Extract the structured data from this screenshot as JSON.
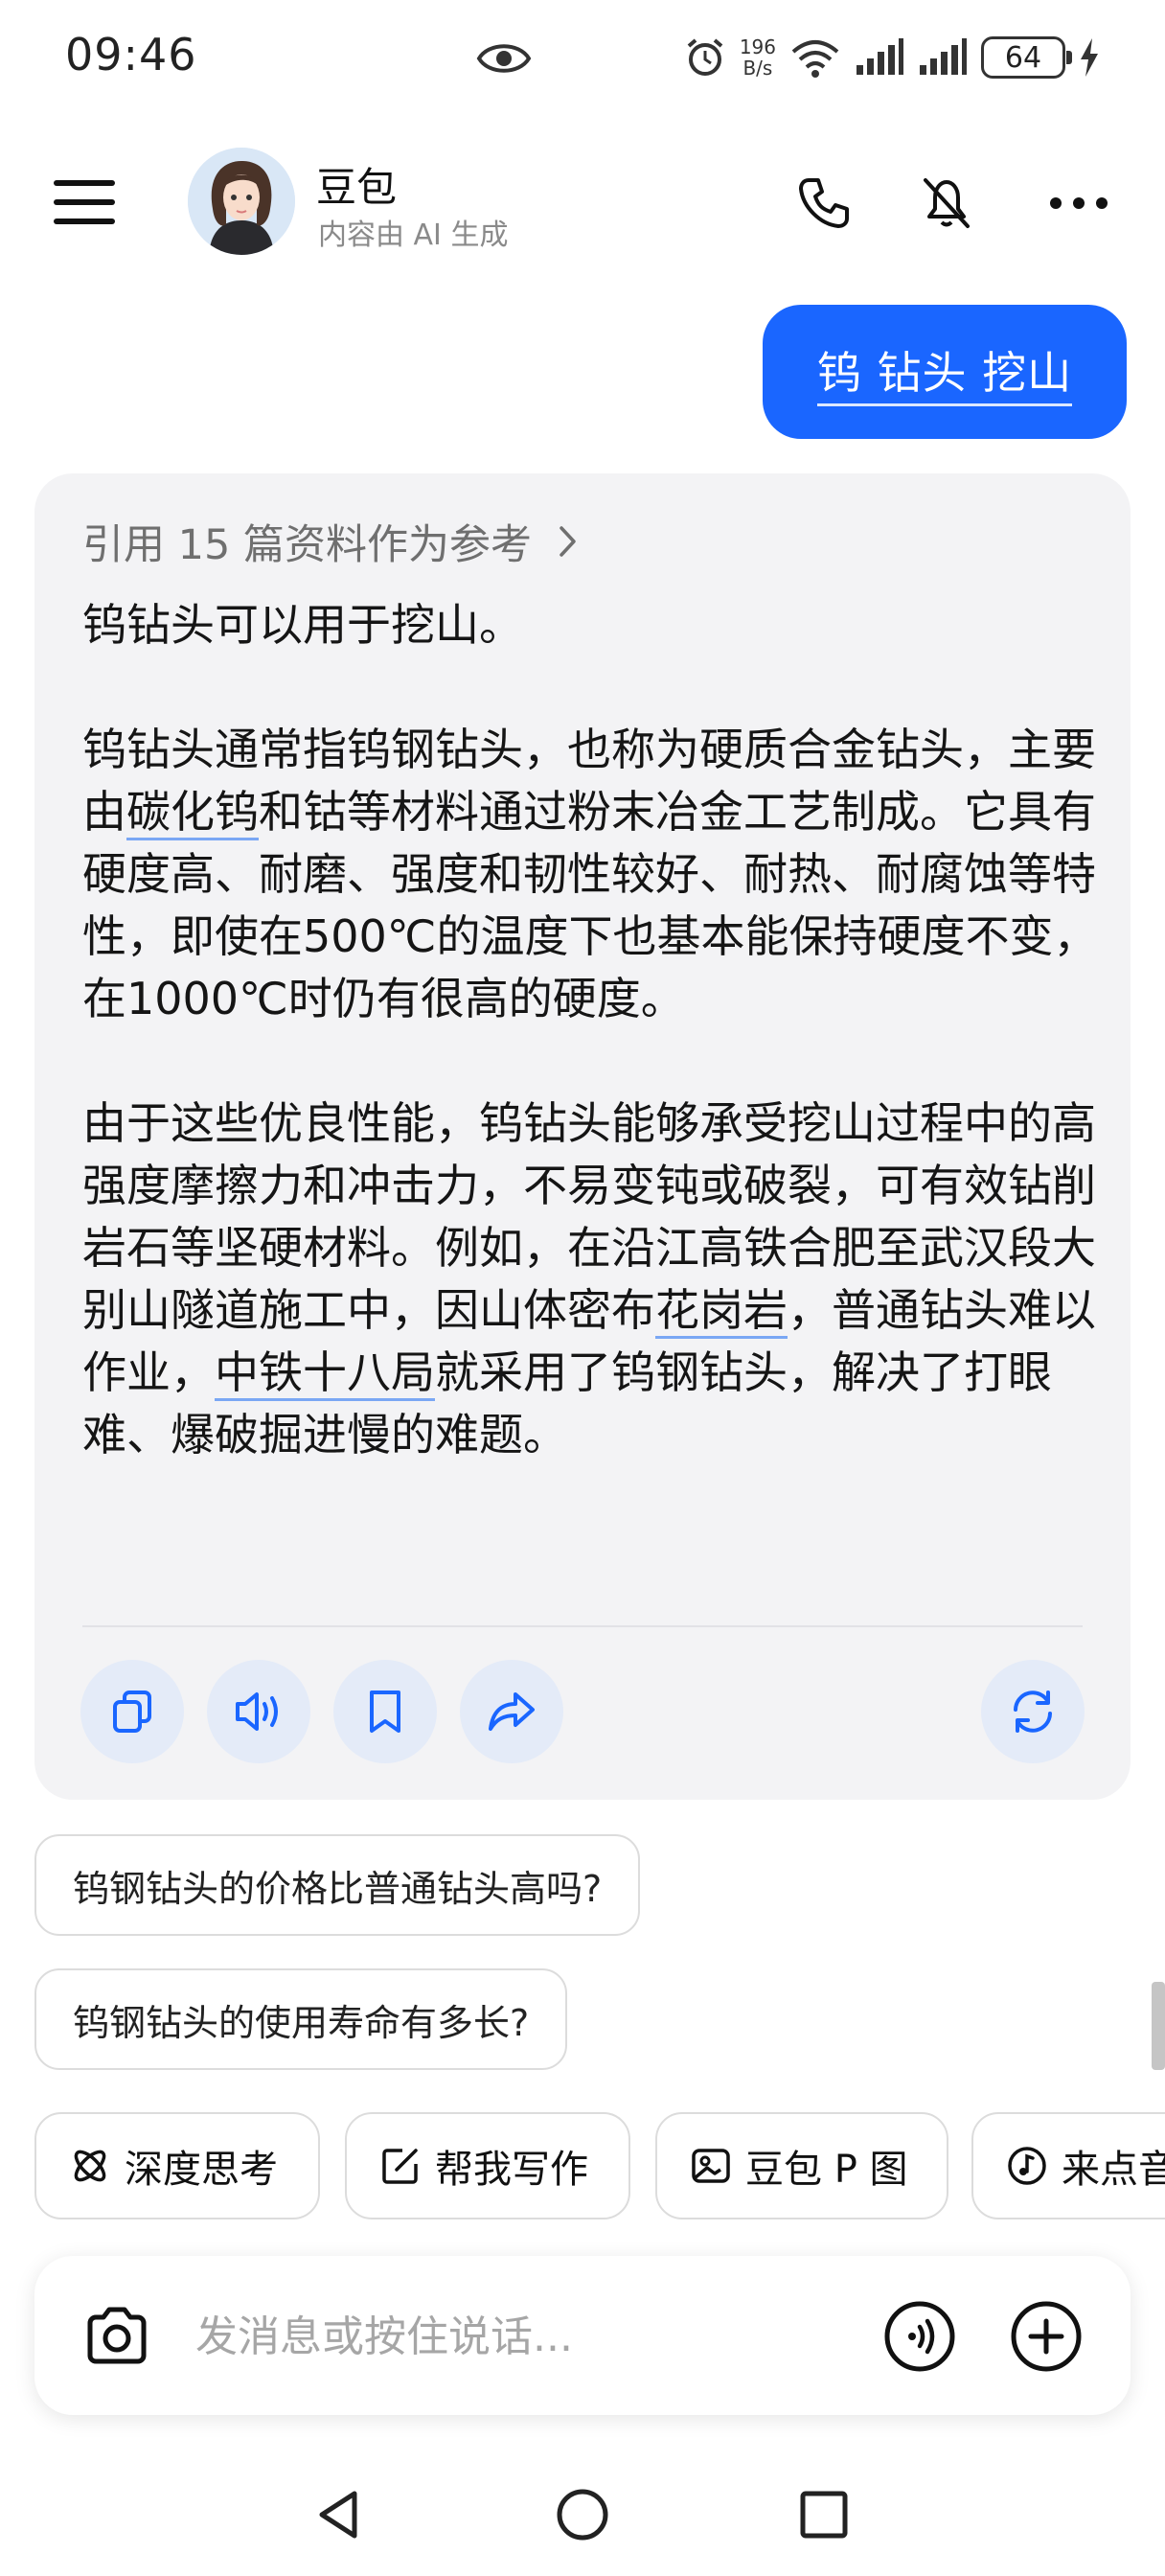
{
  "status_bar": {
    "time": "09:46",
    "net_speed_value": "196",
    "net_speed_unit": "B/s",
    "battery": "64"
  },
  "header": {
    "title": "豆包",
    "subtitle": "内容由 AI 生成"
  },
  "user_message": "钨 钻头 挖山",
  "answer": {
    "reference_label": "引用 15 篇资料作为参考",
    "p1": "钨钻头可以用于挖山。",
    "p2_a": "钨钻头通常指钨钢钻头，也称为硬质合金钻头，主要由",
    "p2_link": "碳化钨",
    "p2_b": "和钴等材料通过粉末冶金工艺制成。它具有硬度高、耐磨、强度和韧性较好、耐热、耐腐蚀等特性，即使在500℃的温度下也基本能保持硬度不变，在1000℃时仍有很高的硬度。",
    "p3_a": "由于这些优良性能，钨钻头能够承受挖山过程中的高强度摩擦力和冲击力，不易变钝或破裂，可有效钻削岩石等坚硬材料。例如，在沿江高铁合肥至武汉段大别山隧道施工中，因山体密布",
    "p3_link1": "花岗岩",
    "p3_b": "，普通钻头难以作业，",
    "p3_link2": "中铁十八局",
    "p3_c": "就采用了钨钢钻头，解决了打眼难、爆破掘进慢的难题。"
  },
  "suggestions": [
    "钨钢钻头的价格比普通钻头高吗?",
    "钨钢钻头的使用寿命有多长?"
  ],
  "chips": [
    {
      "label": "深度思考",
      "icon": "atom-icon"
    },
    {
      "label": "帮我写作",
      "icon": "edit-icon"
    },
    {
      "label": "豆包 P 图",
      "icon": "image-edit-icon"
    },
    {
      "label": "来点音",
      "icon": "music-icon"
    }
  ],
  "input": {
    "placeholder": "发消息或按住说话..."
  },
  "colors": {
    "accent": "#1a66ff",
    "card_bg": "#f3f3f5",
    "action_bg": "#e4ebf8",
    "action_icon": "#1a66ff"
  }
}
